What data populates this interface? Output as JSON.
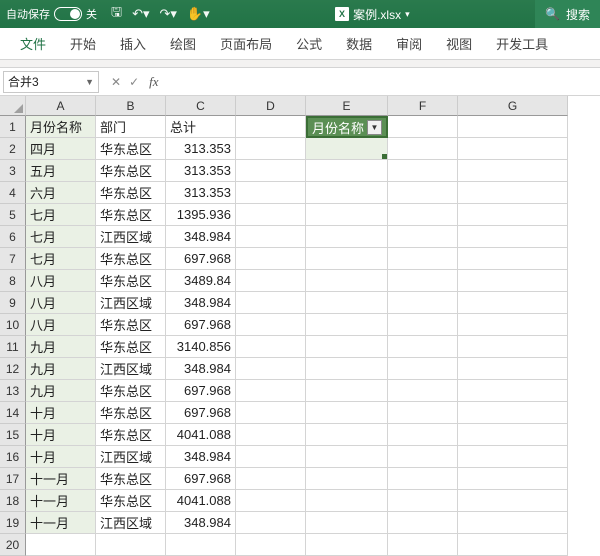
{
  "titlebar": {
    "autosave_label": "自动保存",
    "autosave_state": "关",
    "filename": "案例.xlsx",
    "search_label": "搜索"
  },
  "qat_icons": [
    "save",
    "undo",
    "redo",
    "touch"
  ],
  "ribbon": {
    "tabs": [
      "文件",
      "开始",
      "插入",
      "绘图",
      "页面布局",
      "公式",
      "数据",
      "审阅",
      "视图",
      "开发工具"
    ]
  },
  "namebox": {
    "value": "合并3"
  },
  "fx_label": "fx",
  "columns": [
    "A",
    "B",
    "C",
    "D",
    "E",
    "F",
    "G"
  ],
  "col_widths": [
    "wA",
    "wB",
    "wC",
    "wD",
    "wE",
    "wF",
    "wG"
  ],
  "headers": {
    "A": "月份名称",
    "B": "部门",
    "C": "总计"
  },
  "pivot": {
    "header": "月份名称"
  },
  "rows": [
    {
      "a": "四月",
      "b": "华东总区",
      "c": "313.353"
    },
    {
      "a": "五月",
      "b": "华东总区",
      "c": "313.353"
    },
    {
      "a": "六月",
      "b": "华东总区",
      "c": "313.353"
    },
    {
      "a": "七月",
      "b": "华东总区",
      "c": "1395.936"
    },
    {
      "a": "七月",
      "b": "江西区域",
      "c": "348.984"
    },
    {
      "a": "七月",
      "b": "华东总区",
      "c": "697.968"
    },
    {
      "a": "八月",
      "b": "华东总区",
      "c": "3489.84"
    },
    {
      "a": "八月",
      "b": "江西区域",
      "c": "348.984"
    },
    {
      "a": "八月",
      "b": "华东总区",
      "c": "697.968"
    },
    {
      "a": "九月",
      "b": "华东总区",
      "c": "3140.856"
    },
    {
      "a": "九月",
      "b": "江西区域",
      "c": "348.984"
    },
    {
      "a": "九月",
      "b": "华东总区",
      "c": "697.968"
    },
    {
      "a": "十月",
      "b": "华东总区",
      "c": "697.968"
    },
    {
      "a": "十月",
      "b": "华东总区",
      "c": "4041.088"
    },
    {
      "a": "十月",
      "b": "江西区域",
      "c": "348.984"
    },
    {
      "a": "十一月",
      "b": "华东总区",
      "c": "697.968"
    },
    {
      "a": "十一月",
      "b": "华东总区",
      "c": "4041.088"
    },
    {
      "a": "十一月",
      "b": "江西区域",
      "c": "348.984"
    }
  ],
  "last_row_num": "20"
}
